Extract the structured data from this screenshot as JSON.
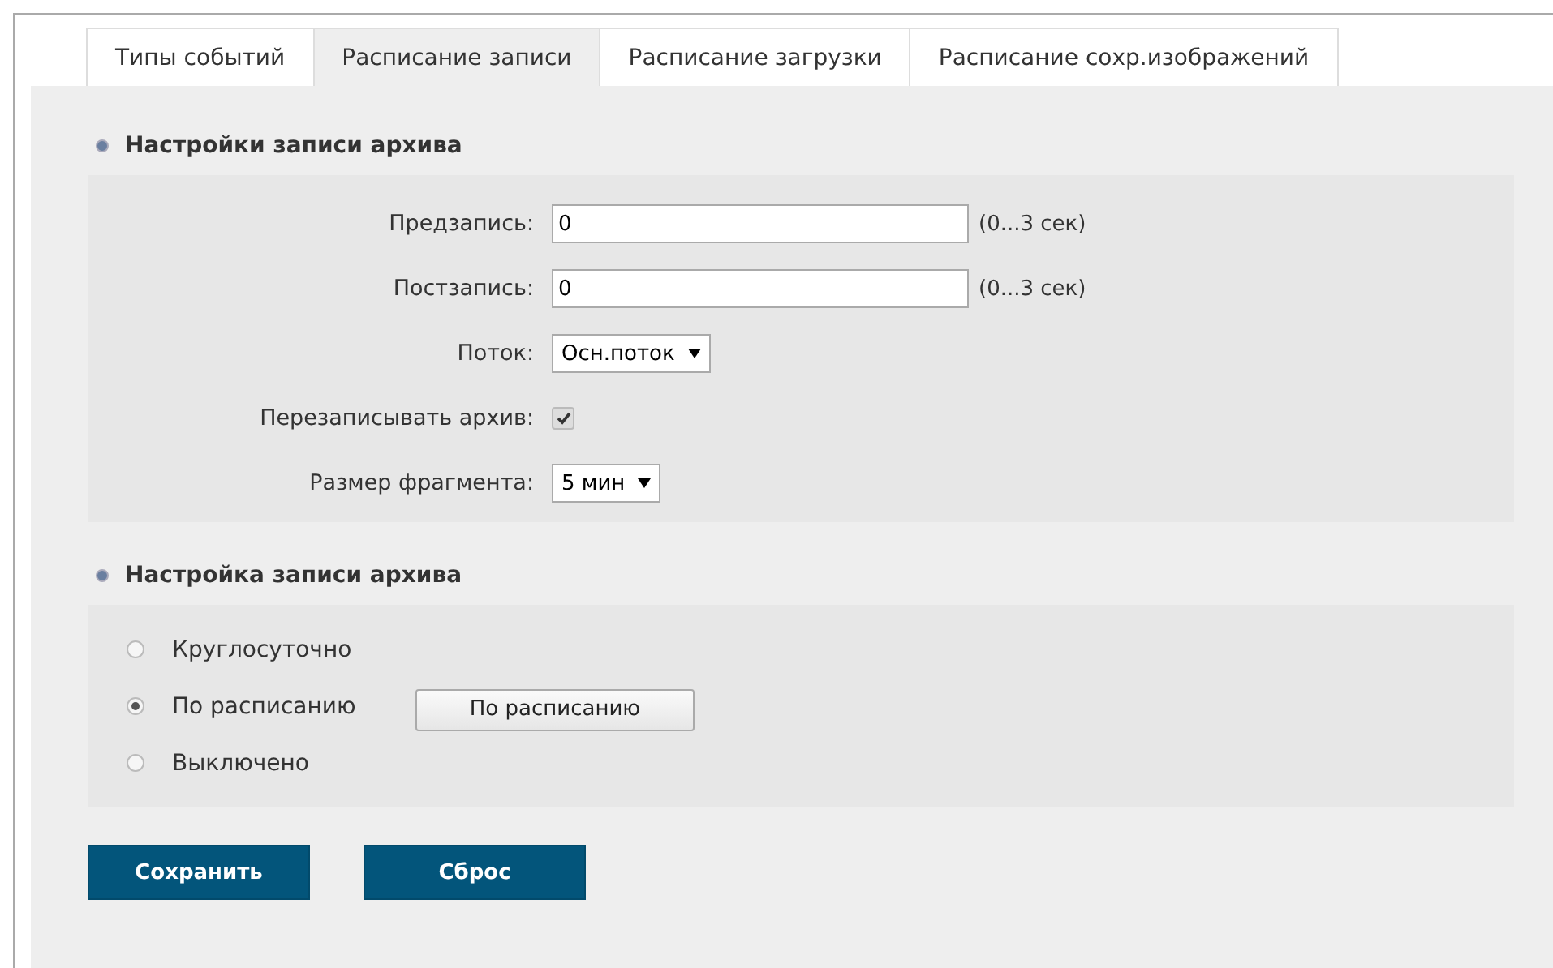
{
  "tabs": [
    {
      "label": "Типы событий",
      "selected": false
    },
    {
      "label": "Расписание записи",
      "selected": true
    },
    {
      "label": "Расписание загрузки",
      "selected": false
    },
    {
      "label": "Расписание сохр.изображений",
      "selected": false
    }
  ],
  "archive_settings": {
    "title": "Настройки записи архива",
    "fields": [
      {
        "kind": "text",
        "label": "Предзапись:",
        "value": "0",
        "hint": "(0...3 сек)"
      },
      {
        "kind": "text",
        "label": "Постзапись:",
        "value": "0",
        "hint": "(0...3 сек)"
      },
      {
        "kind": "select",
        "label": "Поток:",
        "value": "Осн.поток"
      },
      {
        "kind": "checkbox",
        "label": "Перезаписывать архив:",
        "checked": true
      },
      {
        "kind": "select",
        "label": "Размер фрагмента:",
        "value": "5 мин"
      }
    ]
  },
  "recording_mode": {
    "title": "Настройка записи архива",
    "options": [
      {
        "label": "Круглосуточно",
        "selected": false
      },
      {
        "label": "По расписанию",
        "selected": true,
        "button": "По расписанию"
      },
      {
        "label": "Выключено",
        "selected": false
      }
    ]
  },
  "buttons": [
    "Сохранить",
    "Сброс"
  ]
}
